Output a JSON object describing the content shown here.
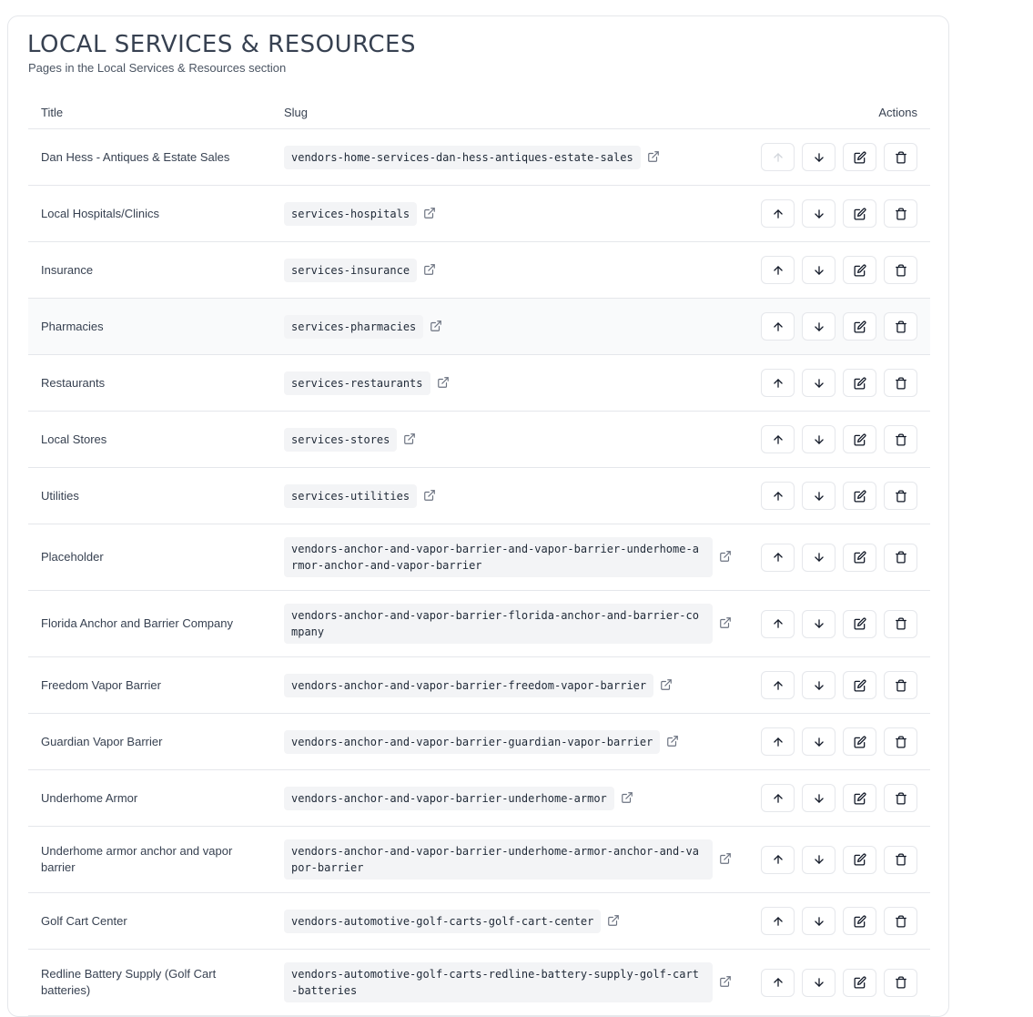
{
  "header": {
    "title": "LOCAL SERVICES & RESOURCES",
    "subtitle": "Pages in the Local Services & Resources section"
  },
  "table": {
    "columns": {
      "title": "Title",
      "slug": "Slug",
      "actions": "Actions"
    },
    "rows": [
      {
        "title": "Dan Hess - Antiques & Estate Sales",
        "slug": "vendors-home-services-dan-hess-antiques-estate-sales",
        "move_up_disabled": true
      },
      {
        "title": "Local Hospitals/Clinics",
        "slug": "services-hospitals"
      },
      {
        "title": "Insurance",
        "slug": "services-insurance"
      },
      {
        "title": "Pharmacies",
        "slug": "services-pharmacies",
        "highlighted": true
      },
      {
        "title": "Restaurants",
        "slug": "services-restaurants"
      },
      {
        "title": "Local Stores",
        "slug": "services-stores"
      },
      {
        "title": "Utilities",
        "slug": "services-utilities"
      },
      {
        "title": "Placeholder",
        "slug": "vendors-anchor-and-vapor-barrier-and-vapor-barrier-underhome-armor-anchor-and-vapor-barrier"
      },
      {
        "title": "Florida Anchor and Barrier Company",
        "slug": "vendors-anchor-and-vapor-barrier-florida-anchor-and-barrier-company"
      },
      {
        "title": "Freedom Vapor Barrier",
        "slug": "vendors-anchor-and-vapor-barrier-freedom-vapor-barrier"
      },
      {
        "title": "Guardian Vapor Barrier",
        "slug": "vendors-anchor-and-vapor-barrier-guardian-vapor-barrier"
      },
      {
        "title": "Underhome Armor",
        "slug": "vendors-anchor-and-vapor-barrier-underhome-armor"
      },
      {
        "title": "Underhome armor anchor and vapor barrier",
        "slug": "vendors-anchor-and-vapor-barrier-underhome-armor-anchor-and-vapor-barrier"
      },
      {
        "title": "Golf Cart Center",
        "slug": "vendors-automotive-golf-carts-golf-cart-center"
      },
      {
        "title": "Redline Battery Supply (Golf Cart batteries)",
        "slug": "vendors-automotive-golf-carts-redline-battery-supply-golf-cart-batteries"
      }
    ]
  },
  "icons": {
    "external_link": "external-link-icon",
    "move_up": "arrow-up-icon",
    "move_down": "arrow-down-icon",
    "edit": "edit-icon",
    "delete": "trash-icon"
  }
}
